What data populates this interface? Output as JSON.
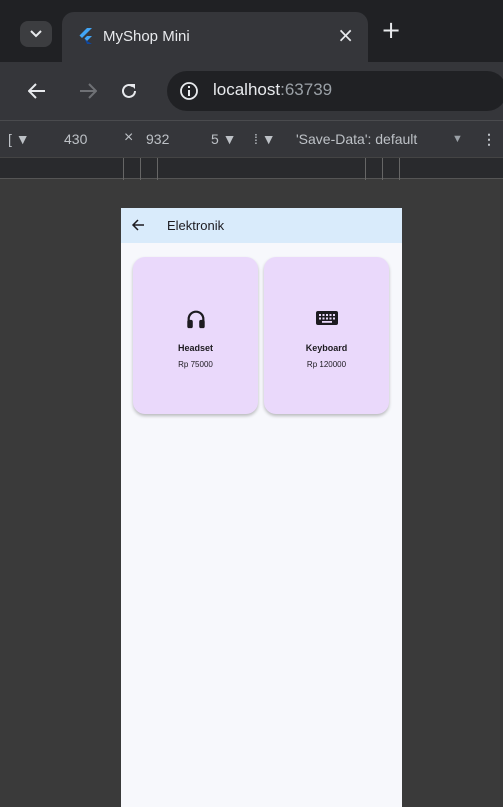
{
  "browser": {
    "tab_title": "MyShop Mini",
    "tab_close": "×",
    "new_tab": "+",
    "url_host": "localhost",
    "url_port": ":63739"
  },
  "devtools": {
    "dimensions_label": "[ ▼",
    "width": "430",
    "times": "×",
    "height": "932",
    "dpr_label": "5 ▼",
    "throttle_label": "⁞ ▼",
    "save_data": "'Save-Data': default",
    "save_data_arrow": "▼",
    "more": "⋮"
  },
  "app": {
    "title": "Elektronik",
    "accent": "#d9ebfb",
    "card_color": "#ead9fb",
    "products": [
      {
        "name": "Headset",
        "price": "Rp 75000",
        "icon": "headset-icon"
      },
      {
        "name": "Keyboard",
        "price": "Rp 120000",
        "icon": "keyboard-icon"
      }
    ]
  }
}
